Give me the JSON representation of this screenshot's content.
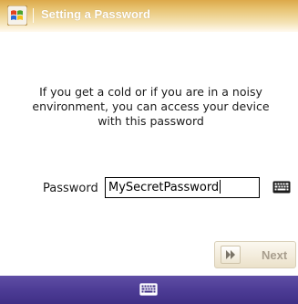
{
  "window": {
    "title": "Setting a Password",
    "icon": "windows-flag-icon"
  },
  "message": "If you get a cold or if you are in a noisy environment, you can access your device with this password",
  "password": {
    "label": "Password",
    "value": "MySecretPassword",
    "keyboard_icon": "keyboard-icon"
  },
  "next_button": {
    "label": "Next",
    "icon": "double-arrow-right-icon"
  },
  "bottom_bar": {
    "keyboard_icon": "keyboard-icon"
  },
  "colors": {
    "title_bar": "#e0b55c",
    "bottom_bar": "#4d3c95",
    "next_label": "#a89e8e"
  }
}
